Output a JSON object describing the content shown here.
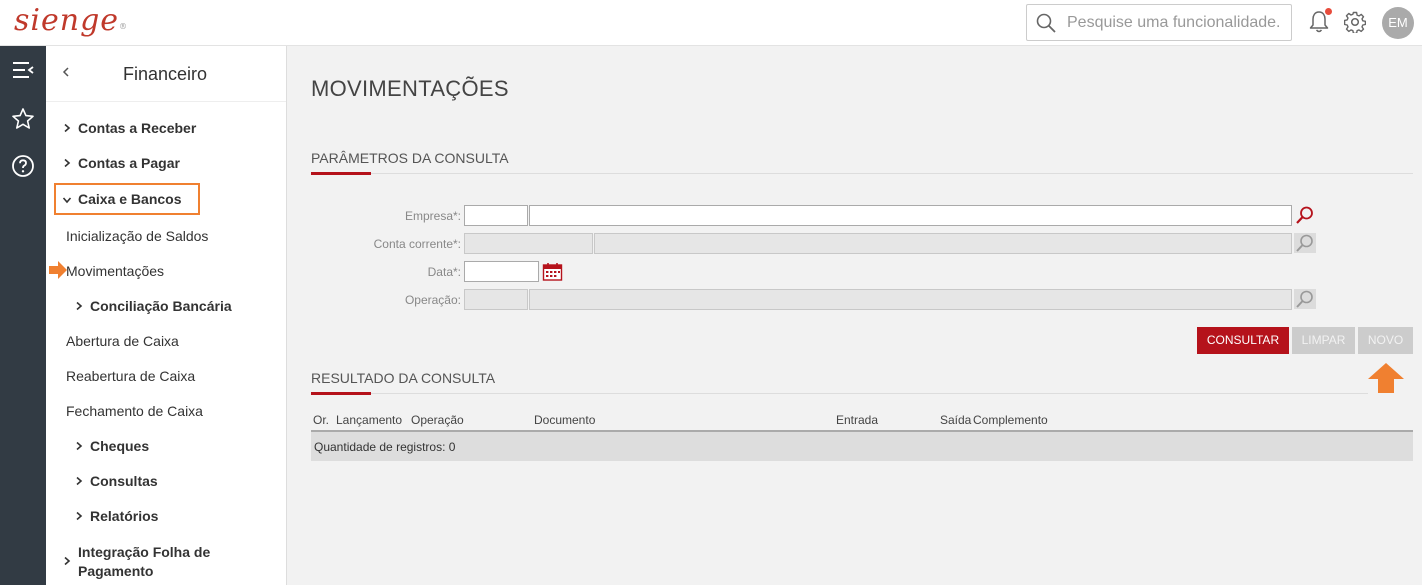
{
  "header": {
    "logo_text": "sienge",
    "search_placeholder": "Pesquise uma funcionalidade.",
    "avatar_initials": "EM",
    "accent_color": "#b5121b",
    "notification_dot_color": "#e74c3c"
  },
  "rail": {
    "icons": [
      "menu-collapse-icon",
      "star-icon",
      "help-icon"
    ]
  },
  "sidebar": {
    "title": "Financeiro",
    "items": [
      {
        "label": "Contas a Receber",
        "level": 0,
        "expandable": true,
        "expanded": false
      },
      {
        "label": "Contas a Pagar",
        "level": 0,
        "expandable": true,
        "expanded": false
      },
      {
        "label": "Caixa e Bancos",
        "level": 0,
        "expandable": true,
        "expanded": true
      },
      {
        "label": "Inicialização de Saldos",
        "level": 1,
        "expandable": false
      },
      {
        "label": "Movimentações",
        "level": 1,
        "expandable": false,
        "active": true
      },
      {
        "label": "Conciliação Bancária",
        "level": 1,
        "expandable": true,
        "expanded": false
      },
      {
        "label": "Abertura de Caixa",
        "level": 1,
        "expandable": false
      },
      {
        "label": "Reabertura de Caixa",
        "level": 1,
        "expandable": false
      },
      {
        "label": "Fechamento de Caixa",
        "level": 1,
        "expandable": false
      },
      {
        "label": "Cheques",
        "level": 1,
        "expandable": true,
        "expanded": false
      },
      {
        "label": "Consultas",
        "level": 1,
        "expandable": true,
        "expanded": false
      },
      {
        "label": "Relatórios",
        "level": 1,
        "expandable": true,
        "expanded": false
      },
      {
        "label": "Integração Folha de",
        "label2": "Pagamento",
        "level": 0,
        "expandable": true,
        "expanded": false
      }
    ]
  },
  "main": {
    "page_title": "MOVIMENTAÇÕES",
    "params_section_title": "PARÂMETROS DA CONSULTA",
    "fields": {
      "empresa": {
        "label": "Empresa*:",
        "code": "",
        "name": ""
      },
      "conta_corrente": {
        "label": "Conta corrente*:",
        "code": "",
        "name": "",
        "disabled": true
      },
      "data": {
        "label": "Data*:",
        "value": ""
      },
      "operacao": {
        "label": "Operação:",
        "code": "",
        "name": "",
        "disabled": true
      }
    },
    "buttons": {
      "consultar": "CONSULTAR",
      "limpar": "LIMPAR",
      "novo": "NOVO"
    },
    "results_section_title": "RESULTADO DA CONSULTA",
    "table": {
      "columns": [
        "Or.",
        "Lançamento",
        "Operação",
        "Documento",
        "Entrada",
        "Saída",
        "Complemento"
      ],
      "rows": [],
      "count_text": "Quantidade de registros: 0"
    }
  }
}
